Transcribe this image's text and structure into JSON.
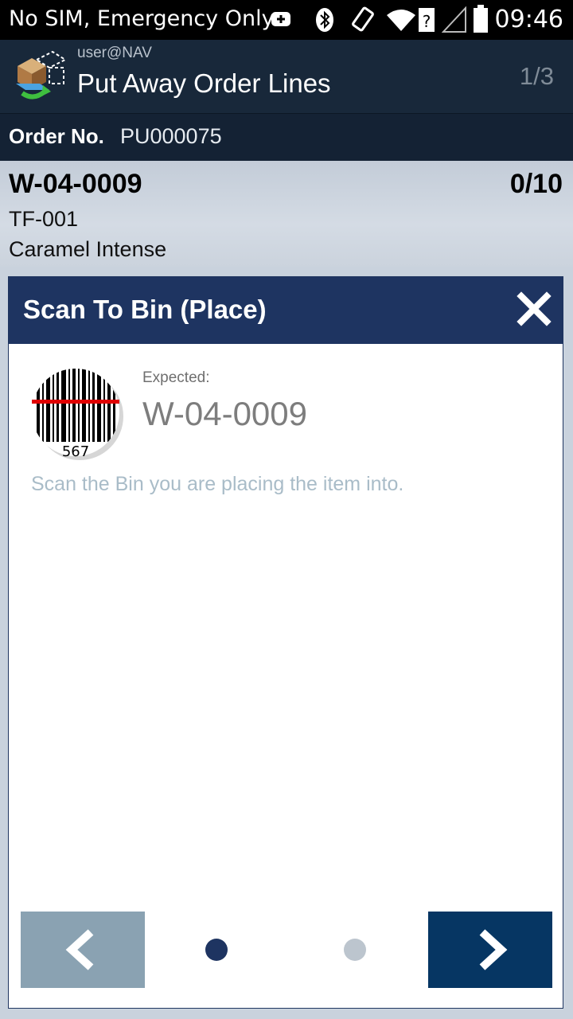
{
  "status_bar": {
    "carrier": "No SIM, Emergency Only",
    "time": "09:46",
    "icons": [
      "add-icon",
      "bluetooth-icon",
      "vibrate-icon",
      "wifi-icon",
      "signal-icon",
      "battery-icon"
    ]
  },
  "app_bar": {
    "user": "user@NAV",
    "title": "Put Away Order Lines",
    "pager": "1/3"
  },
  "order": {
    "label": "Order No.",
    "number": "PU000075"
  },
  "item": {
    "bin": "W-04-0009",
    "quantity": "0/10",
    "code": "TF-001",
    "description": "Caramel Intense"
  },
  "dialog": {
    "title": "Scan To Bin (Place)",
    "barcode_digits": "567",
    "expected_label": "Expected:",
    "expected_value": "W-04-0009",
    "instruction": "Scan the Bin you are placing the item into.",
    "page_dots": {
      "count": 2,
      "active_index": 0
    }
  },
  "colors": {
    "header_bg": "#18283a",
    "dialog_header": "#1e3461",
    "next_button": "#063663",
    "prev_button": "#8aa2b2",
    "instruction_text": "#a9bcc8"
  }
}
